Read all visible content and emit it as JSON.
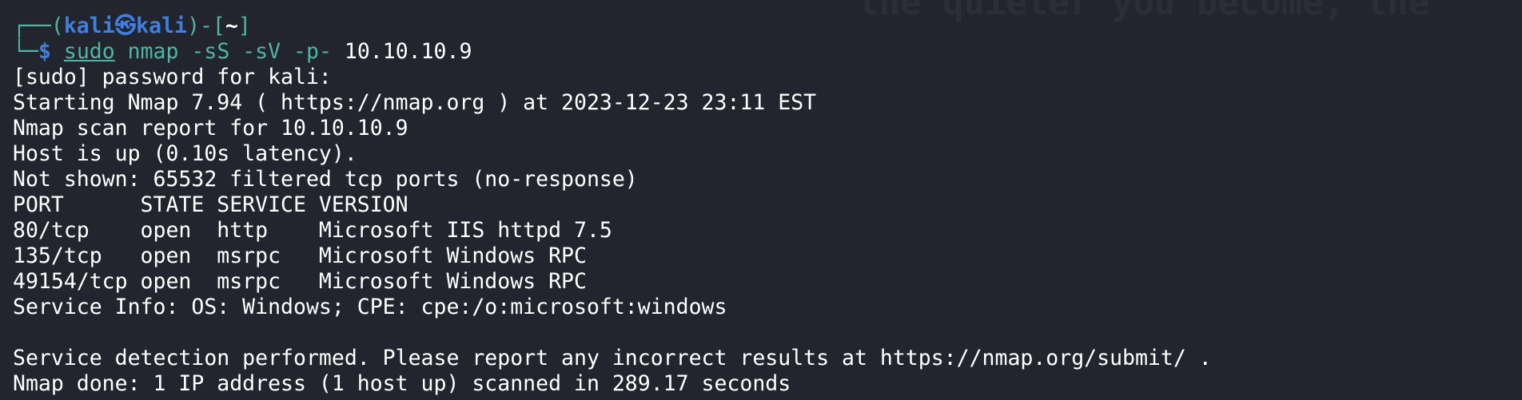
{
  "watermark": "the quieter you become, the",
  "prompt": {
    "corner_top": "┌──",
    "paren_open": "(",
    "user": "kali",
    "separator": "㉿",
    "host": "kali",
    "paren_close_dash": ")-[",
    "cwd": "~",
    "bracket_close": "]",
    "corner_bottom": "└─",
    "dollar": "$",
    "space": " ",
    "cmd_sudo": "sudo",
    "cmd_args": " nmap -sS -sV -p- ",
    "cmd_target": "10.10.10.9"
  },
  "output": [
    "[sudo] password for kali:",
    "Starting Nmap 7.94 ( https://nmap.org ) at 2023-12-23 23:11 EST",
    "Nmap scan report for 10.10.10.9",
    "Host is up (0.10s latency).",
    "Not shown: 65532 filtered tcp ports (no-response)",
    "PORT      STATE SERVICE VERSION",
    "80/tcp    open  http    Microsoft IIS httpd 7.5",
    "135/tcp   open  msrpc   Microsoft Windows RPC",
    "49154/tcp open  msrpc   Microsoft Windows RPC",
    "Service Info: OS: Windows; CPE: cpe:/o:microsoft:windows",
    "",
    "Service detection performed. Please report any incorrect results at https://nmap.org/submit/ .",
    "Nmap done: 1 IP address (1 host up) scanned in 289.17 seconds"
  ],
  "colors": {
    "background": "#23252e",
    "prompt_frame": "#4fb5a3",
    "prompt_user": "#3f7fe0",
    "text": "#ffffff"
  }
}
